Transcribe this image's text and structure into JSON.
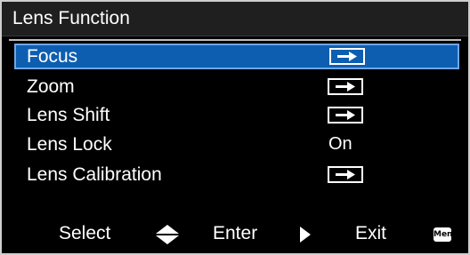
{
  "menu": {
    "title": "Lens Function",
    "items": [
      {
        "label": "Focus",
        "value_type": "arrow",
        "selected": true
      },
      {
        "label": "Zoom",
        "value_type": "arrow",
        "selected": false
      },
      {
        "label": "Lens Shift",
        "value_type": "arrow",
        "selected": false
      },
      {
        "label": "Lens Lock",
        "value_type": "text",
        "value": "On",
        "selected": false
      },
      {
        "label": "Lens Calibration",
        "value_type": "arrow",
        "selected": false
      }
    ]
  },
  "footer": {
    "select_label": "Select",
    "enter_label": "Enter",
    "exit_label": "Exit",
    "menu_button_label": "Menu",
    "select_icon": "up-down-arrows-icon",
    "enter_icon": "right-triangle-icon",
    "exit_icon": "menu-button-icon"
  },
  "colors": {
    "background": "#000000",
    "highlight": "#0d5eb0",
    "text": "#ffffff"
  }
}
